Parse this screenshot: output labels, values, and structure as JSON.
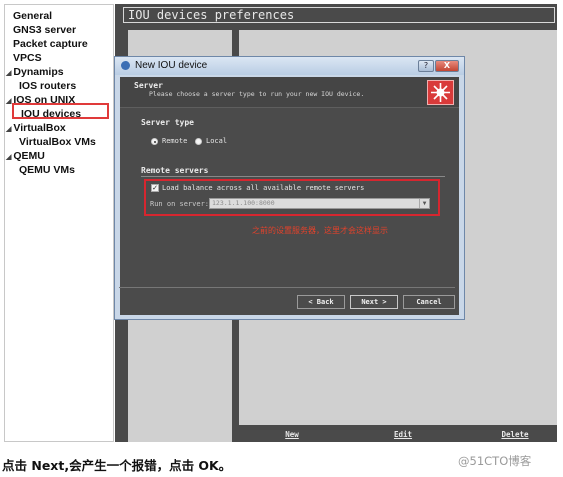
{
  "tree": {
    "items": [
      {
        "label": "General",
        "arrow": ""
      },
      {
        "label": "GNS3 server",
        "arrow": ""
      },
      {
        "label": "Packet capture",
        "arrow": ""
      },
      {
        "label": "VPCS",
        "arrow": ""
      },
      {
        "label": "Dynamips",
        "arrow": "◢"
      },
      {
        "label": "IOS routers",
        "arrow": ""
      },
      {
        "label": "IOS on UNIX",
        "arrow": "◢"
      },
      {
        "label": "IOU devices",
        "arrow": ""
      },
      {
        "label": "VirtualBox",
        "arrow": "◢"
      },
      {
        "label": "VirtualBox VMs",
        "arrow": ""
      },
      {
        "label": "QEMU",
        "arrow": "◢"
      },
      {
        "label": "QEMU VMs",
        "arrow": ""
      }
    ]
  },
  "preferences": {
    "title": "IOU devices preferences",
    "buttons": {
      "new": "New",
      "edit": "Edit",
      "delete": "Delete"
    }
  },
  "dialog": {
    "title": "New IOU device",
    "help_label": "?",
    "close_label": "X",
    "header_title": "Server",
    "header_subtitle": "Please choose a server type to run your new IOU device.",
    "server_type": {
      "section": "Server type",
      "remote_label": "Remote",
      "local_label": "Local",
      "selected": "Remote"
    },
    "remote_servers": {
      "section": "Remote servers",
      "load_balance_label": "Load balance across all available remote servers",
      "load_balance_checked": true,
      "check_mark": "✓",
      "run_on_label": "Run on server:",
      "run_on_value": "123.1.1.100:8000"
    },
    "annotation": "之前的设置服务器，这里才会这样显示",
    "buttons": {
      "back": "< Back",
      "next": "Next >",
      "cancel": "Cancel"
    }
  },
  "caption": "点击 Next,会产生一个报错，点击 OK。",
  "watermark": "@51CTO博客",
  "colors": {
    "highlight_border": "#e03a3a",
    "annotation": "#e2422b"
  }
}
